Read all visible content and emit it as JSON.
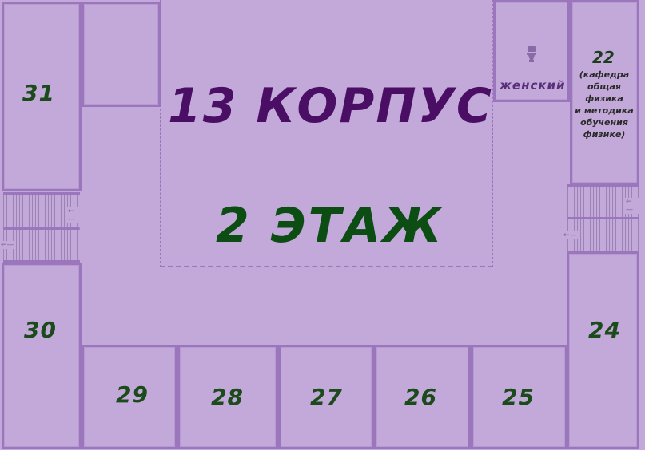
{
  "building": {
    "title": "13 КОРПУС",
    "floor": "2 ЭТАЖ"
  },
  "toilet": {
    "label": "женский",
    "icon": "toilet-icon"
  },
  "department": {
    "number": "22",
    "lines": [
      "(кафедра",
      "общая",
      "физика",
      "и методика",
      "обучения",
      "физике)"
    ]
  },
  "rooms": {
    "r31": "31",
    "r30": "30",
    "r29": "29",
    "r28": "28",
    "r27": "27",
    "r26": "26",
    "r25": "25",
    "r24": "24"
  },
  "stairs": {
    "arrow_text": "←—"
  },
  "colors": {
    "background": "#c3a9d9",
    "wall": "#9b76bd",
    "title": "#4a0f65",
    "floor": "#0b4d12",
    "room_number": "#1b4a1b"
  }
}
